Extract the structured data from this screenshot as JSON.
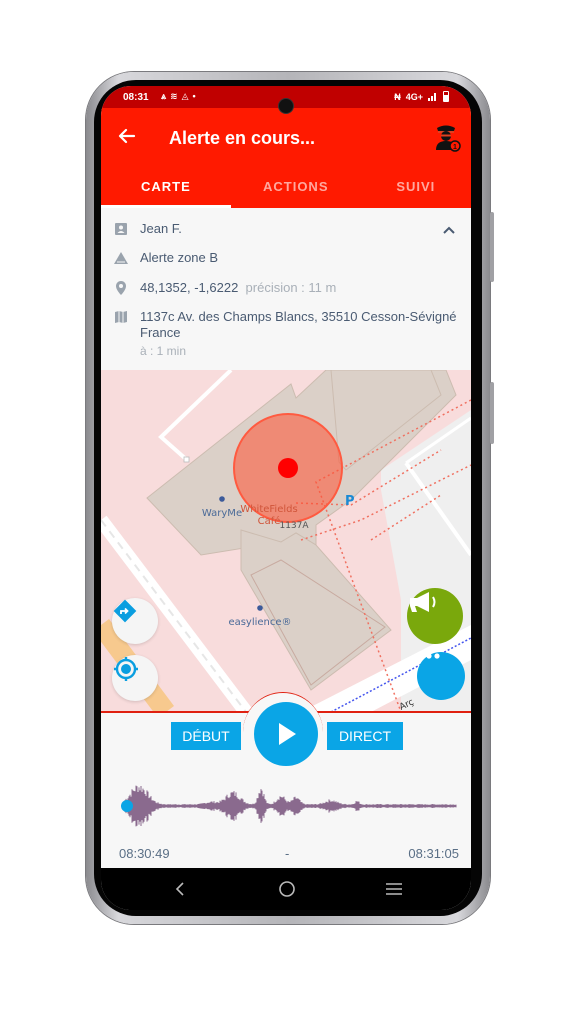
{
  "status_bar": {
    "time": "08:31",
    "left_icons": [
      "signal-tower-icon",
      "wifi-off-icon",
      "warning-triangle-icon",
      "dot-icon"
    ],
    "network": "4G+",
    "right_icons": [
      "nfc-icon",
      "signal-bars-icon",
      "battery-icon"
    ]
  },
  "app_bar": {
    "title": "Alerte en cours...",
    "back_icon": "arrow-left-icon",
    "agent_icon": "security-agent-icon",
    "agent_badge": "1"
  },
  "tabs": [
    {
      "label": "CARTE",
      "active": true
    },
    {
      "label": "ACTIONS",
      "active": false
    },
    {
      "label": "SUIVI",
      "active": false
    }
  ],
  "info": {
    "user_name": "Jean F.",
    "alert_name": "Alerte zone B",
    "coordinates": "48,1352,  -1,6222",
    "precision": "précision : 11 m",
    "address_line1": "1137c Av. des Champs Blancs, 35510 Cesson-Sévigné",
    "address_line2": "France",
    "age": "à : 1 min"
  },
  "map": {
    "labels": {
      "cafe_line1": "WhiteFields",
      "cafe_line2": "Café",
      "waryme": "WaryMe",
      "building_number": "1137A",
      "easylience": "easylience®",
      "parking": "P",
      "street_fragment": "Arç"
    },
    "accent_alert": "#ff1a00",
    "buttons": {
      "directions_icon": "directions-icon",
      "locate_icon": "my-location-icon",
      "megaphone_icon": "megaphone-icon",
      "more_icon": "more-horizontal-icon"
    }
  },
  "player": {
    "start_label": "DÉBUT",
    "live_label": "DIRECT",
    "play_icon": "play-icon",
    "time_start": "08:30:49",
    "time_separator": "-",
    "time_end": "08:31:05",
    "progress": 0,
    "accent": "#0aa5e6",
    "wave_color": "#7d5a82"
  },
  "nav_bar": {
    "icons": [
      "back-nav-icon",
      "home-nav-icon",
      "recents-nav-icon"
    ]
  }
}
